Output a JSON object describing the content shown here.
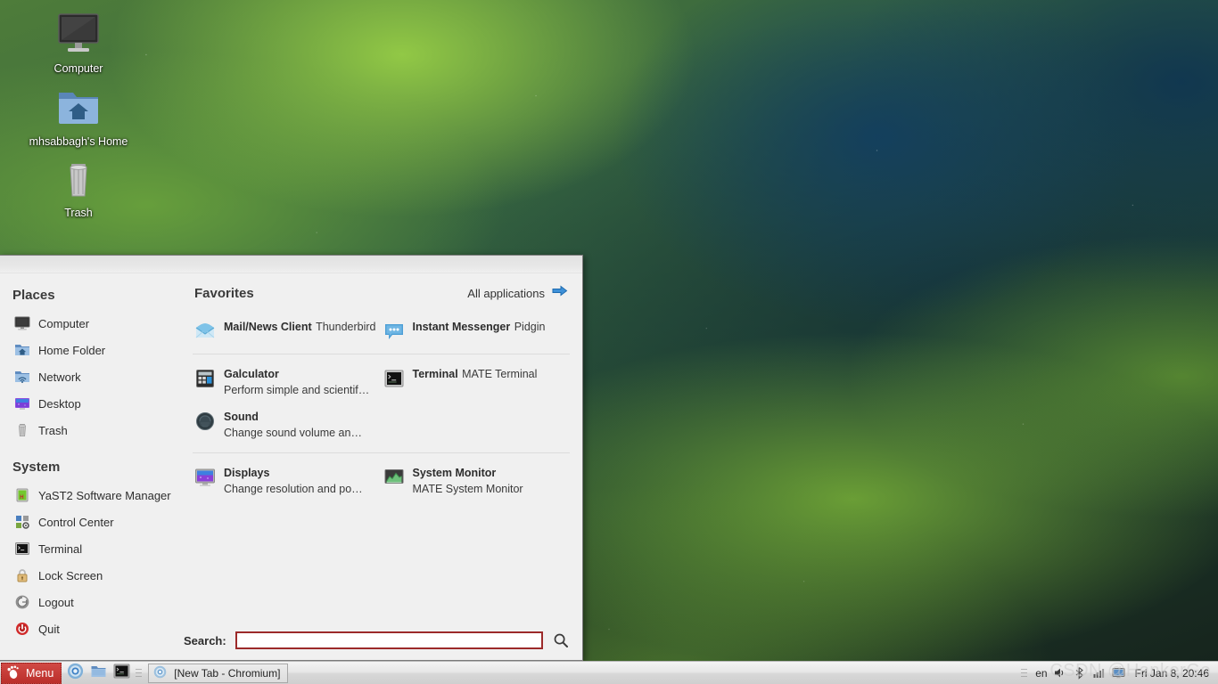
{
  "desktop": {
    "icons": [
      {
        "label": "Computer",
        "icon": "computer-icon"
      },
      {
        "label": "mhsabbagh's Home",
        "icon": "home-folder-icon"
      },
      {
        "label": "Trash",
        "icon": "trash-icon"
      }
    ]
  },
  "menu": {
    "places": {
      "title": "Places",
      "items": [
        {
          "label": "Computer",
          "icon": "computer-icon"
        },
        {
          "label": "Home Folder",
          "icon": "home-folder-icon"
        },
        {
          "label": "Network",
          "icon": "network-icon"
        },
        {
          "label": "Desktop",
          "icon": "desktop-icon"
        },
        {
          "label": "Trash",
          "icon": "trash-icon"
        }
      ]
    },
    "system": {
      "title": "System",
      "items": [
        {
          "label": "YaST2 Software Manager",
          "icon": "yast-icon"
        },
        {
          "label": "Control Center",
          "icon": "control-center-icon"
        },
        {
          "label": "Terminal",
          "icon": "terminal-icon"
        },
        {
          "label": "Lock Screen",
          "icon": "lock-icon"
        },
        {
          "label": "Logout",
          "icon": "logout-icon"
        },
        {
          "label": "Quit",
          "icon": "power-icon"
        }
      ]
    },
    "favorites": {
      "title": "Favorites",
      "all_applications_label": "All applications",
      "all_applications_icon": "arrow-right-icon",
      "groups": [
        {
          "items": [
            {
              "name": "Mail/News Client",
              "desc": "Thunderbird",
              "icon": "mail-icon"
            },
            {
              "name": "Instant Messenger",
              "desc": "Pidgin",
              "icon": "chat-icon"
            }
          ]
        },
        {
          "items": [
            {
              "name": "Galculator",
              "desc": "Perform simple and scientif…",
              "icon": "calculator-icon"
            },
            {
              "name": "Terminal",
              "desc": "MATE Terminal",
              "icon": "terminal-icon"
            },
            {
              "name": "Sound",
              "desc": "Change sound volume an…",
              "icon": "sound-icon"
            }
          ]
        },
        {
          "items": [
            {
              "name": "Displays",
              "desc": "Change resolution and po…",
              "icon": "displays-icon"
            },
            {
              "name": "System Monitor",
              "desc": "MATE System Monitor",
              "icon": "system-monitor-icon"
            }
          ]
        }
      ]
    },
    "search": {
      "label": "Search:",
      "value": "",
      "placeholder": "",
      "icon": "search-icon"
    }
  },
  "taskbar": {
    "menu_button": {
      "label": "Menu",
      "icon": "mate-footprint-icon"
    },
    "launchers": [
      {
        "name": "chromium-launcher",
        "icon": "chromium-icon"
      },
      {
        "name": "file-manager-launcher",
        "icon": "folder-icon"
      },
      {
        "name": "terminal-launcher",
        "icon": "terminal-icon"
      }
    ],
    "window_buttons": [
      {
        "label": "[New Tab - Chromium]",
        "icon": "chromium-icon"
      }
    ],
    "tray": {
      "language": "en",
      "icons": [
        "volume-icon",
        "bluetooth-icon",
        "network-signal-icon",
        "display-icon"
      ],
      "clock": "Fri Jan 8, 20:46"
    }
  },
  "watermark": "CSDN @HankerGo",
  "colors": {
    "menu_background": "#f0f0f0",
    "menu_border": "#7a7a7a",
    "menu_button_red": "#bb2f2b",
    "search_border": "#9c2a2a",
    "accent_blue": "#2a7fd4",
    "separator": "#dcdcdc",
    "text_primary": "#2d2d2d",
    "text_heading": "#3b3b3b"
  }
}
